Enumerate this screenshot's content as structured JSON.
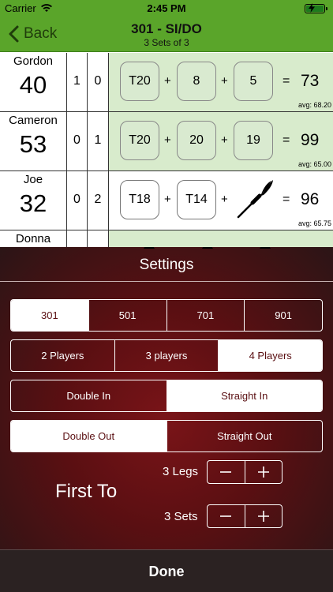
{
  "status_bar": {
    "carrier": "Carrier",
    "time": "2:45 PM"
  },
  "nav": {
    "back_label": "Back",
    "title": "301 - SI/DO",
    "subtitle": "3 Sets of 3"
  },
  "players": [
    {
      "name": "Gordon",
      "score": "40",
      "sets": "1",
      "legs": "0",
      "darts": [
        "T20",
        "8",
        "5"
      ],
      "equals": "=",
      "total": "73",
      "avg": "avg: 68.20",
      "active": false
    },
    {
      "name": "Cameron",
      "score": "53",
      "sets": "0",
      "legs": "1",
      "darts": [
        "T20",
        "20",
        "19"
      ],
      "equals": "=",
      "total": "99",
      "avg": "avg: 65.00",
      "active": false
    },
    {
      "name": "Joe",
      "score": "32",
      "sets": "0",
      "legs": "2",
      "darts": [
        "T18",
        "T14"
      ],
      "equals": "=",
      "total": "96",
      "avg": "avg: 65.75",
      "active": true
    },
    {
      "name": "Donna"
    }
  ],
  "plus_sign": "+",
  "settings": {
    "title": "Settings",
    "game_options": [
      {
        "label": "301",
        "selected": true
      },
      {
        "label": "501",
        "selected": false
      },
      {
        "label": "701",
        "selected": false
      },
      {
        "label": "901",
        "selected": false
      }
    ],
    "player_options": [
      {
        "label": "2 Players",
        "selected": false
      },
      {
        "label": "3 players",
        "selected": false
      },
      {
        "label": "4 Players",
        "selected": true
      }
    ],
    "in_options": [
      {
        "label": "Double In",
        "selected": false
      },
      {
        "label": "Straight In",
        "selected": true
      }
    ],
    "out_options": [
      {
        "label": "Double Out",
        "selected": true
      },
      {
        "label": "Straight Out",
        "selected": false
      }
    ],
    "first_to_label": "First To",
    "legs_label": "3 Legs",
    "sets_label": "3 Sets",
    "done_label": "Done"
  },
  "colors": {
    "nav_green": "#5aa52a",
    "row_green": "#d8ebcc",
    "settings_red": "#5a0f12"
  },
  "icons": {
    "back": "chevron-left-icon",
    "dart": "dart-icon",
    "minus": "minus-icon",
    "plus": "plus-icon"
  }
}
